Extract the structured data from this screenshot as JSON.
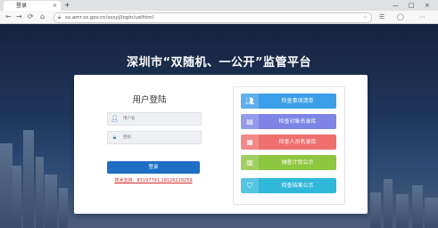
{
  "browser": {
    "tab_title": "登录",
    "tab_close": "×",
    "new_tab": "+",
    "window_controls": [
      "—",
      "□",
      "×"
    ],
    "nav": [
      "←",
      "→",
      "⟳",
      "⌂"
    ],
    "url": "sx.amr.sz.gov.cn/ssxyj/login/uelhtml"
  },
  "page": {
    "title": "深圳市“双随机、一公开”监管平台",
    "login": {
      "title": "用户登陆",
      "username_placeholder": "用户名",
      "password_placeholder": "密码",
      "submit_label": "登录",
      "support_text": "技术支持：83197791,18126229259"
    },
    "quick_links": [
      {
        "label": "检查事项清单",
        "color": "#3b9ee8",
        "icon": "person-icon"
      },
      {
        "label": "检查对象名录库",
        "color": "#7d84e6",
        "icon": "document-icon"
      },
      {
        "label": "检查人员名录库",
        "color": "#ef6f6f",
        "icon": "id-card-icon"
      },
      {
        "label": "抽查计划公示",
        "color": "#8dc63f",
        "icon": "calendar-icon"
      },
      {
        "label": "检查结果公示",
        "color": "#2fb8d9",
        "icon": "shield-icon"
      }
    ]
  }
}
